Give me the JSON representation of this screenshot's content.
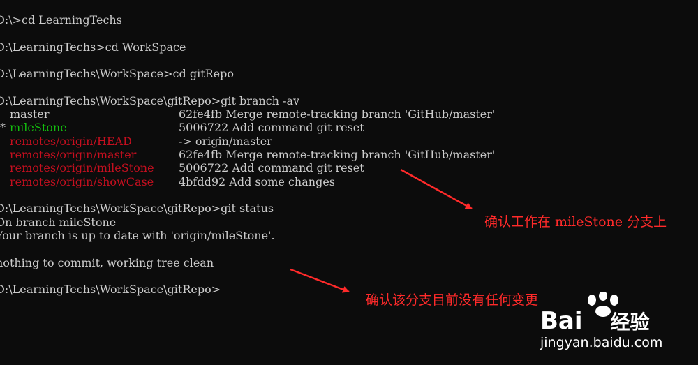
{
  "terminal": {
    "commands": [
      "D:\\>cd LearningTechs",
      "D:\\LearningTechs>cd WorkSpace",
      "D:\\LearningTechs\\WorkSpace>cd gitRepo",
      "D:\\LearningTechs\\WorkSpace\\gitRepo>git branch -av"
    ],
    "branches": [
      {
        "marker": "",
        "name": "master",
        "info": "62fe4fb Merge remote-tracking branch 'GitHub/master'"
      },
      {
        "marker": "*",
        "name": "mileStone",
        "info": "5006722 Add command git reset"
      },
      {
        "marker": "",
        "name": "remotes/origin/HEAD",
        "info": "-> origin/master"
      },
      {
        "marker": "",
        "name": "remotes/origin/master",
        "info": "62fe4fb Merge remote-tracking branch 'GitHub/master'"
      },
      {
        "marker": "",
        "name": "remotes/origin/mileStone",
        "info": "5006722 Add command git reset"
      },
      {
        "marker": "",
        "name": "remotes/origin/showCase",
        "info": "4bfdd92 Add some changes"
      }
    ],
    "status_command": "D:\\LearningTechs\\WorkSpace\\gitRepo>git status",
    "status_lines": [
      "On branch mileStone",
      "Your branch is up to date with 'origin/mileStone'.",
      "nothing to commit, working tree clean"
    ],
    "final_prompt": "D:\\LearningTechs\\WorkSpace\\gitRepo>"
  },
  "annotations": {
    "first": "确认工作在 mileStone 分支上",
    "second": "确认该分支目前没有任何变更"
  },
  "watermark": {
    "brand": "Bai",
    "brand_suffix": "经验",
    "url": "jingyan.baidu.com"
  },
  "colors": {
    "background": "#0c0c0c",
    "text": "#cccccc",
    "current_branch": "#13c10e",
    "remote_branch": "#c50f1f",
    "annotation": "#ff2a2a"
  }
}
